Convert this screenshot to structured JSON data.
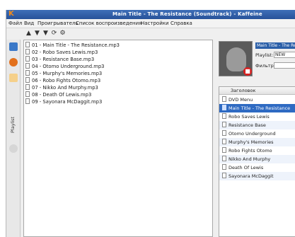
{
  "window": {
    "title": "Main Title - The Resistance (Soundtrack) - Kaffeine"
  },
  "menu": {
    "items": [
      "Файл",
      "Вид",
      "Проигрыватель",
      "Список воспроизведения",
      "Настройки",
      "Справка"
    ]
  },
  "toolbar": {
    "buttons": [
      "arrow-up-icon",
      "arrow-down-icon",
      "arrow-down-icon",
      "refresh-icon",
      "settings-icon"
    ]
  },
  "sidebar": {
    "label": "Playlist"
  },
  "files": [
    "01 - Main Title - The Resistance.mp3",
    "02 - Robo Saves Lewis.mp3",
    "03 - Resistance Base.mp3",
    "04 - Otomo Underground.mp3",
    "05 - Murphy's Memories.mp3",
    "06 - Robo Fights Otomo.mp3",
    "07 - Nikko And Murphy.mp3",
    "08 - Death Of Lewis.mp3",
    "09 - Sayonara McDaggit.mp3"
  ],
  "info": {
    "title": "Main Title - The Resistance",
    "playlist_label": "Playlist:",
    "playlist_value": "NEW",
    "filter_label": "Фильтр:",
    "filter_value": ""
  },
  "playlist": {
    "header": "Заголовок",
    "rows": [
      {
        "title": "DVD Menu",
        "state": "normal"
      },
      {
        "title": "Main Title - The Resistance",
        "state": "selected"
      },
      {
        "title": "Robo Saves Lewis",
        "state": "normal"
      },
      {
        "title": "Resistance Base",
        "state": "alt"
      },
      {
        "title": "Otomo Underground",
        "state": "normal"
      },
      {
        "title": "Murphy's Memories",
        "state": "alt"
      },
      {
        "title": "Robo Fights Otomo",
        "state": "normal"
      },
      {
        "title": "Nikko And Murphy",
        "state": "alt"
      },
      {
        "title": "Death Of Lewis",
        "state": "normal"
      },
      {
        "title": "Sayonara McDaggit",
        "state": "alt"
      }
    ]
  },
  "colors": {
    "titlebar": "#2f5fa8",
    "selection": "#2e6ac2",
    "app_icon": "#f08a1c"
  }
}
